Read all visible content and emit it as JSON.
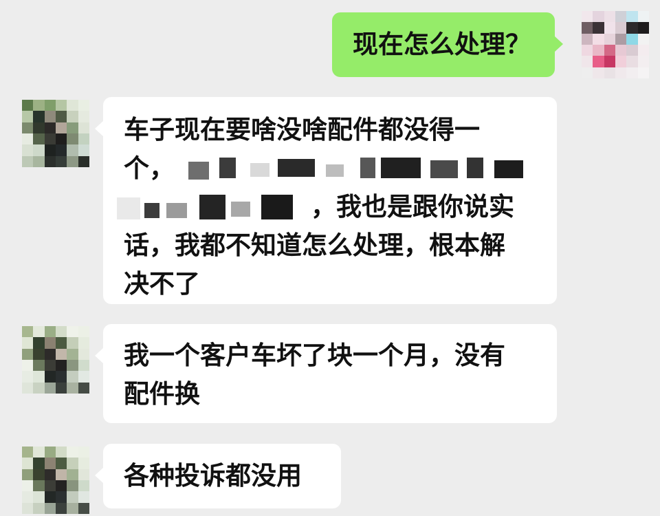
{
  "conversation": {
    "messages": [
      {
        "side": "right",
        "lines": [
          "现在怎么处理？"
        ]
      },
      {
        "side": "left",
        "lines": [
          "车子现在要啥没啥配件都没得一",
          "个，",
          "，我也是跟你说实",
          "话，我都不知道怎么处理，根本解",
          "决不了"
        ]
      },
      {
        "side": "left",
        "lines": [
          "我一个客户车坏了块一个月，没有",
          "配件换"
        ]
      },
      {
        "side": "left",
        "lines": [
          "各种投诉都没用"
        ]
      }
    ]
  }
}
